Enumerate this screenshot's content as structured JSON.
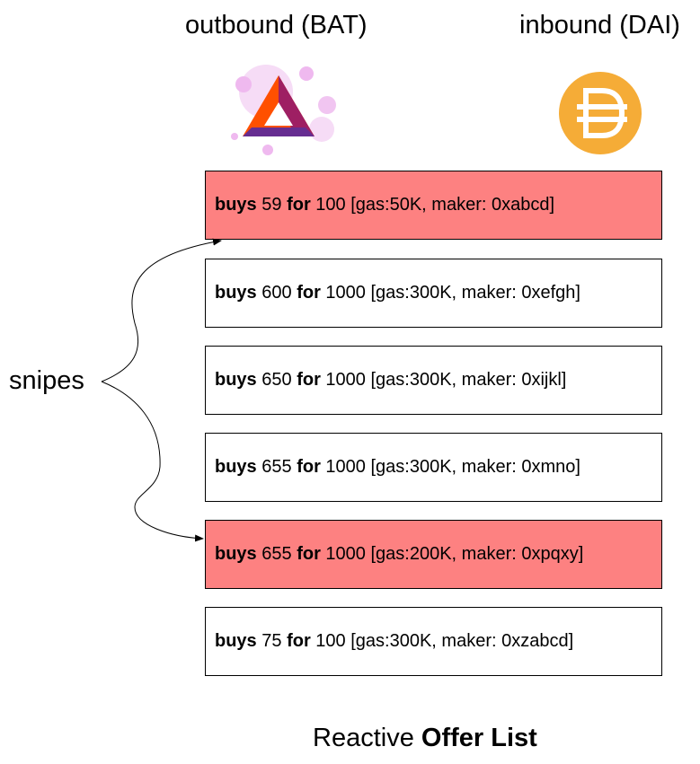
{
  "headers": {
    "outbound": "outbound (BAT)",
    "inbound": "inbound (DAI)"
  },
  "icons": {
    "outbound": "bat-logo-icon",
    "inbound": "dai-logo-icon"
  },
  "offers": [
    {
      "verb": "buys",
      "amount": "59",
      "for_word": "for",
      "price": "100",
      "details": "[gas:50K, maker: 0xabcd]",
      "sniped": true
    },
    {
      "verb": "buys",
      "amount": "600",
      "for_word": "for",
      "price": "1000",
      "details": "[gas:300K, maker: 0xefgh]",
      "sniped": false
    },
    {
      "verb": "buys",
      "amount": "650",
      "for_word": "for",
      "price": "1000",
      "details": "[gas:300K, maker: 0xijkl]",
      "sniped": false
    },
    {
      "verb": "buys",
      "amount": "655",
      "for_word": "for",
      "price": "1000",
      "details": "[gas:300K, maker: 0xmno]",
      "sniped": false
    },
    {
      "verb": "buys",
      "amount": "655",
      "for_word": "for",
      "price": "1000",
      "details": "[gas:200K, maker: 0xpqxy]",
      "sniped": true
    },
    {
      "verb": "buys",
      "amount": "75",
      "for_word": "for",
      "price": "100",
      "details": "[gas:300K, maker: 0xzabcd]",
      "sniped": false
    }
  ],
  "snipes_label": "snipes",
  "footer": {
    "prefix": "Reactive",
    "bold": "Offer List"
  },
  "colors": {
    "sniped_fill": "#fd8181",
    "normal_fill": "#ffffff",
    "dai": "#f5ac37"
  }
}
